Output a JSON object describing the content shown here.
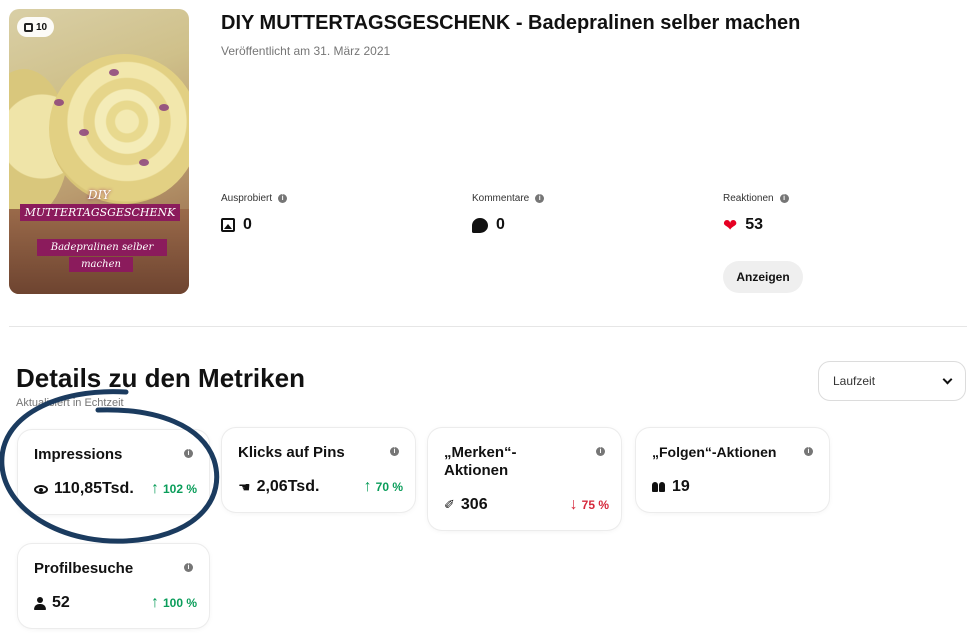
{
  "pin": {
    "image_count": "10",
    "image_text_line1": "DIY",
    "image_text_line2": "MUTTERTAGSGESCHENK",
    "image_text_line3": "Badepralinen selber",
    "image_text_line4": "machen",
    "title": "DIY  MUTTERTAGSGESCHENK - Badepralinen selber machen",
    "published": "Veröffentlicht am 31. März 2021"
  },
  "stats": {
    "tried_label": "Ausprobiert",
    "tried_value": "0",
    "comments_label": "Kommentare",
    "comments_value": "0",
    "reactions_label": "Reaktionen",
    "reactions_value": "53",
    "show_button": "Anzeigen"
  },
  "metrics_section": {
    "title": "Details zu den Metriken",
    "subtitle": "Aktualisiert in Echtzeit",
    "period_select": "Laufzeit"
  },
  "metrics": [
    {
      "label": "Impressions",
      "value": "110,85Tsd.",
      "trend": "102 %",
      "direction": "up",
      "icon": "eye-icon"
    },
    {
      "label": "Klicks auf Pins",
      "value": "2,06Tsd.",
      "trend": "70 %",
      "direction": "up",
      "icon": "click-icon"
    },
    {
      "label": "„Merken“-Aktionen",
      "value": "306",
      "trend": "75 %",
      "direction": "down",
      "icon": "pin-icon"
    },
    {
      "label": "„Folgen“-Aktionen",
      "value": "19",
      "trend": "",
      "direction": "",
      "icon": "people-icon"
    },
    {
      "label": "Profilbesuche",
      "value": "52",
      "trend": "100 %",
      "direction": "up",
      "icon": "person-icon"
    }
  ],
  "colors": {
    "accent": "#e60023",
    "trend_up": "#0a9d5a",
    "trend_down": "#d6283b",
    "annotation_circle": "#1b3b5f"
  },
  "info_glyph": "i",
  "arrow_up": "↑",
  "arrow_down": "↓"
}
